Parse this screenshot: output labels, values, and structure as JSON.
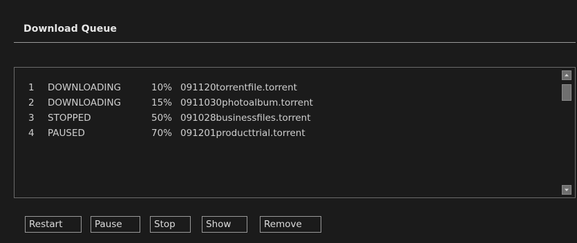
{
  "panel": {
    "title": "Download Queue"
  },
  "queue": {
    "items": [
      {
        "index": "1",
        "status": "DOWNLOADING",
        "progress": "10%",
        "file": "091120torrentfile.torrent"
      },
      {
        "index": "2",
        "status": "DOWNLOADING",
        "progress": "15%",
        "file": "0911030photoalbum.torrent"
      },
      {
        "index": "3",
        "status": "STOPPED",
        "progress": "50%",
        "file": "091028businessfiles.torrent"
      },
      {
        "index": "4",
        "status": "PAUSED",
        "progress": "70%",
        "file": "091201producttrial.torrent"
      }
    ]
  },
  "actions": {
    "restart": "Restart",
    "pause": "Pause",
    "stop": "Stop",
    "show": "Show",
    "remove": "Remove"
  },
  "icons": {
    "scroll_up": "arrow-up-icon",
    "scroll_down": "arrow-down-icon"
  },
  "colors": {
    "background": "#1b1b1b",
    "text": "#cfcfcf",
    "border": "#9a9a9a"
  }
}
